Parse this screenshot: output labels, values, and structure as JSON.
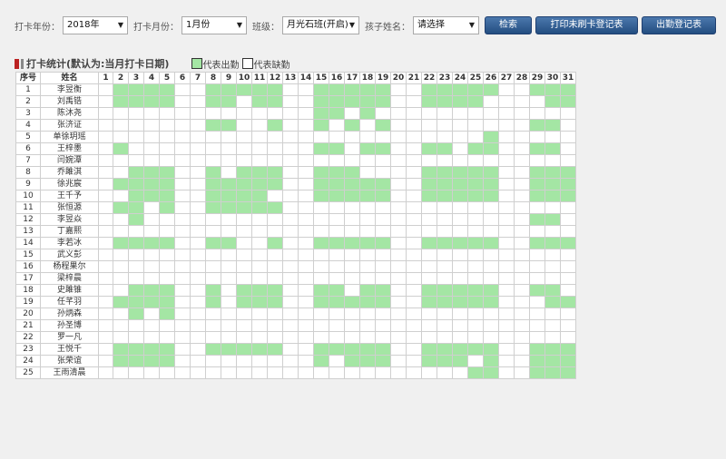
{
  "filters": {
    "year_label": "打卡年份：",
    "year_value": "2018年",
    "month_label": "打卡月份：",
    "month_value": "1月份",
    "class_label": "班级：",
    "class_value": "月光石班(开启)",
    "child_label": "孩子姓名：",
    "child_value": "请选择"
  },
  "buttons": {
    "search": "检索",
    "print_unswiped": "打印未刷卡登记表",
    "attendance": "出勤登记表"
  },
  "section": {
    "title": "打卡统计(默认为:当月打卡日期)",
    "legend_present": "代表出勤",
    "legend_absent": "代表缺勤"
  },
  "colors": {
    "present": "#a4e6a4",
    "absent": "#ffffff",
    "button": "#2f5d93"
  },
  "table": {
    "col_index": "序号",
    "col_name": "姓名",
    "days": [
      "1",
      "2",
      "3",
      "4",
      "5",
      "6",
      "7",
      "8",
      "9",
      "10",
      "11",
      "12",
      "13",
      "14",
      "15",
      "16",
      "17",
      "18",
      "19",
      "20",
      "21",
      "22",
      "23",
      "24",
      "25",
      "26",
      "27",
      "28",
      "29",
      "30",
      "31"
    ],
    "rows": [
      {
        "idx": "1",
        "name": "李昱衡",
        "present": [
          2,
          3,
          4,
          5,
          8,
          9,
          10,
          11,
          12,
          15,
          16,
          17,
          18,
          19,
          22,
          23,
          24,
          25,
          26,
          29,
          30,
          31
        ]
      },
      {
        "idx": "2",
        "name": "刘禹锆",
        "present": [
          2,
          3,
          4,
          5,
          8,
          9,
          11,
          12,
          15,
          16,
          17,
          18,
          19,
          22,
          23,
          24,
          25,
          30,
          31
        ]
      },
      {
        "idx": "3",
        "name": "陈沐尧",
        "present": [
          15,
          16,
          18
        ]
      },
      {
        "idx": "4",
        "name": "张济证",
        "present": [
          8,
          9,
          12,
          15,
          17,
          19,
          29,
          30
        ]
      },
      {
        "idx": "5",
        "name": "单徐玥瑶",
        "present": [
          26
        ]
      },
      {
        "idx": "6",
        "name": "王梓墨",
        "present": [
          2,
          15,
          16,
          18,
          19,
          22,
          23,
          25,
          26,
          29,
          30
        ]
      },
      {
        "idx": "7",
        "name": "闫婉潭",
        "present": []
      },
      {
        "idx": "8",
        "name": "乔雎淇",
        "present": [
          3,
          4,
          5,
          8,
          10,
          11,
          12,
          15,
          16,
          17,
          22,
          23,
          24,
          25,
          26,
          29,
          30,
          31
        ]
      },
      {
        "idx": "9",
        "name": "徐兆宸",
        "present": [
          2,
          3,
          4,
          5,
          8,
          9,
          10,
          11,
          12,
          15,
          16,
          17,
          18,
          19,
          22,
          23,
          24,
          25,
          26,
          29,
          30,
          31
        ]
      },
      {
        "idx": "10",
        "name": "王千予",
        "present": [
          3,
          4,
          5,
          8,
          9,
          10,
          11,
          15,
          16,
          17,
          18,
          19,
          22,
          23,
          24,
          25,
          26,
          29,
          30,
          31
        ]
      },
      {
        "idx": "11",
        "name": "张恒源",
        "present": [
          2,
          3,
          5,
          8,
          9,
          10,
          11,
          12
        ]
      },
      {
        "idx": "12",
        "name": "李昱焱",
        "present": [
          3,
          29,
          30
        ]
      },
      {
        "idx": "13",
        "name": "丁嘉熙",
        "present": []
      },
      {
        "idx": "14",
        "name": "李若冰",
        "present": [
          2,
          3,
          4,
          5,
          8,
          9,
          12,
          15,
          16,
          17,
          18,
          19,
          22,
          23,
          24,
          25,
          26,
          29,
          30,
          31
        ]
      },
      {
        "idx": "15",
        "name": "武义彭",
        "present": []
      },
      {
        "idx": "16",
        "name": "杨程果尔",
        "present": []
      },
      {
        "idx": "17",
        "name": "梁梓晨",
        "present": []
      },
      {
        "idx": "18",
        "name": "史雎锥",
        "present": [
          3,
          4,
          5,
          8,
          10,
          11,
          12,
          15,
          16,
          18,
          19,
          22,
          23,
          24,
          25,
          26,
          29,
          30
        ]
      },
      {
        "idx": "19",
        "name": "任芊羽",
        "present": [
          2,
          3,
          4,
          5,
          8,
          10,
          11,
          12,
          15,
          16,
          17,
          18,
          19,
          22,
          23,
          24,
          25,
          26,
          30,
          31
        ]
      },
      {
        "idx": "20",
        "name": "孙炳森",
        "present": [
          3,
          5
        ]
      },
      {
        "idx": "21",
        "name": "孙圣博",
        "present": []
      },
      {
        "idx": "22",
        "name": "罗一凡",
        "present": []
      },
      {
        "idx": "23",
        "name": "王悦千",
        "present": [
          2,
          3,
          4,
          5,
          8,
          9,
          10,
          11,
          12,
          15,
          16,
          17,
          18,
          19,
          22,
          23,
          24,
          25,
          26,
          29,
          30,
          31
        ]
      },
      {
        "idx": "24",
        "name": "张荣谊",
        "present": [
          2,
          3,
          4,
          5,
          15,
          17,
          18,
          19,
          22,
          23,
          24,
          26,
          29,
          30,
          31
        ]
      },
      {
        "idx": "25",
        "name": "王雨清晨",
        "present": [
          25,
          26,
          29,
          30,
          31
        ]
      }
    ]
  }
}
